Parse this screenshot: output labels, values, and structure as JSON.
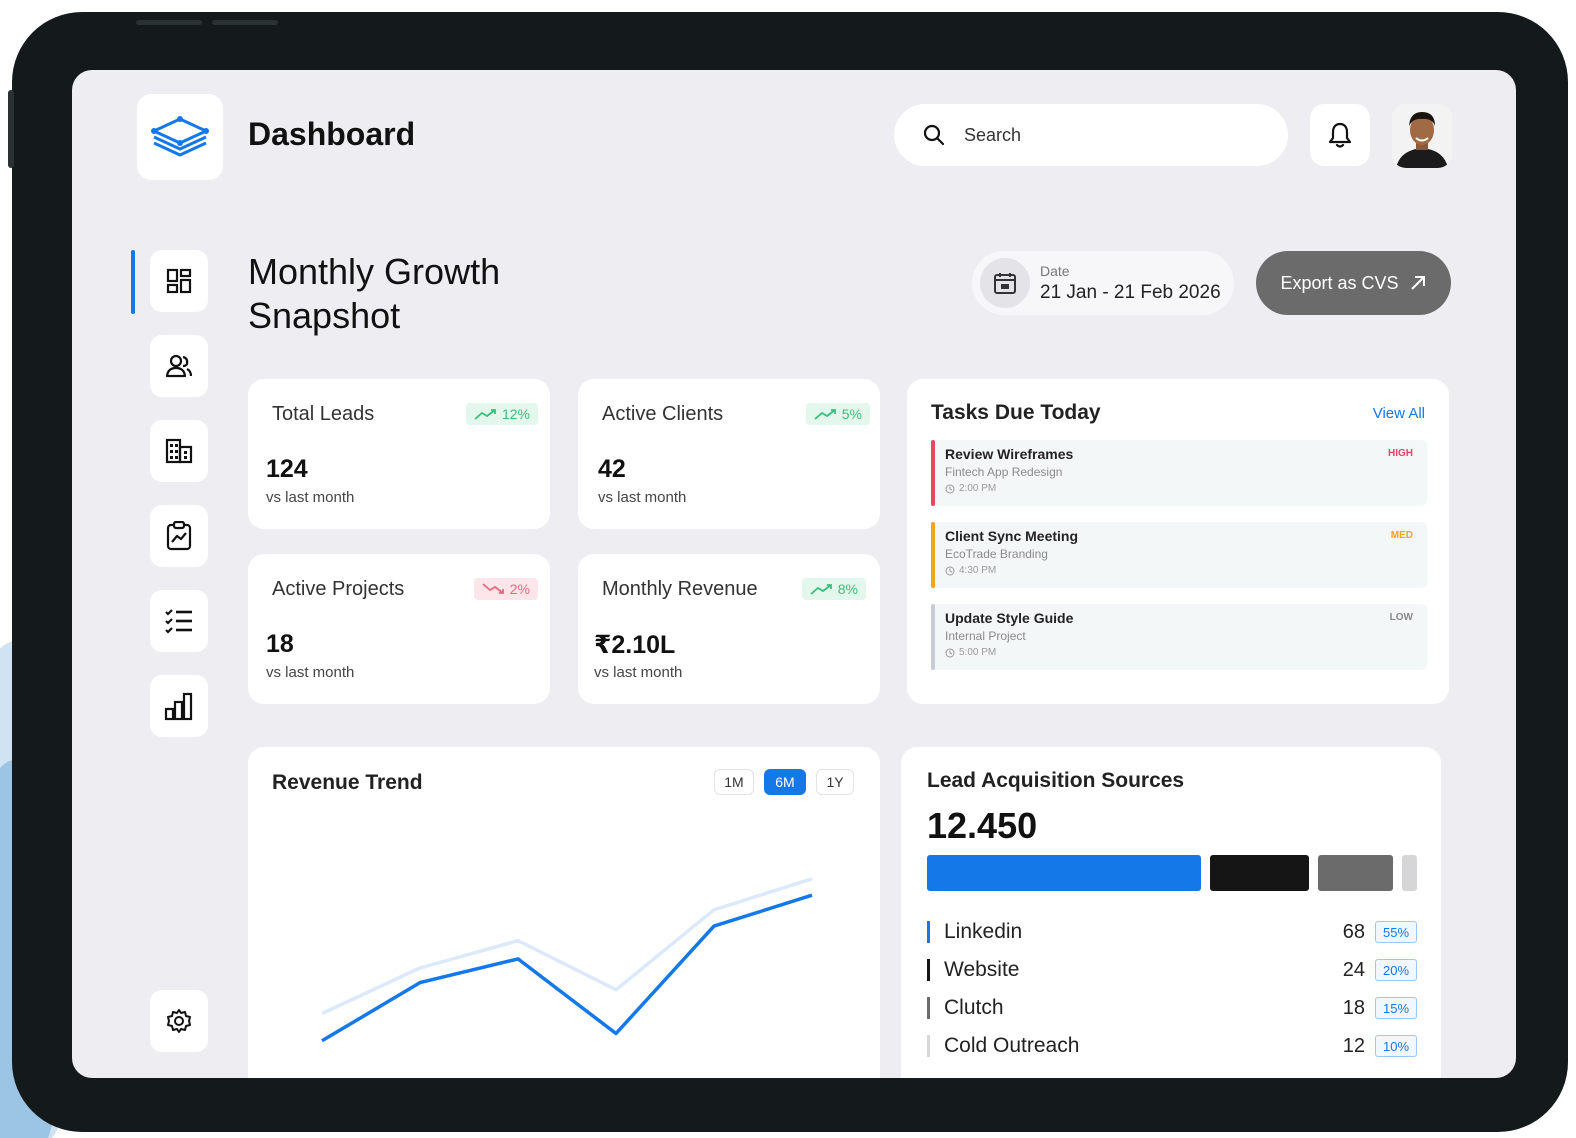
{
  "header": {
    "title": "Dashboard",
    "search_placeholder": "Search"
  },
  "page": {
    "title_line1": "Monthly Growth",
    "title_line2": "Snapshot",
    "date_label": "Date",
    "date_value": "21 Jan - 21 Feb 2026",
    "export_label": "Export as CVS"
  },
  "sidebar": {
    "items": [
      {
        "icon": "dashboard-icon",
        "active": true
      },
      {
        "icon": "users-icon"
      },
      {
        "icon": "building-icon"
      },
      {
        "icon": "report-clipboard-icon"
      },
      {
        "icon": "task-list-icon"
      },
      {
        "icon": "bar-chart-icon"
      },
      {
        "icon": "settings-gear-icon"
      }
    ]
  },
  "stats": [
    {
      "label": "Total Leads",
      "value": "124",
      "sub": "vs last month",
      "change": "12%",
      "trend": "up"
    },
    {
      "label": "Active Clients",
      "value": "42",
      "sub": "vs last month",
      "change": "5%",
      "trend": "up"
    },
    {
      "label": "Active Projects",
      "value": "18",
      "sub": "vs last month",
      "change": "2%",
      "trend": "down"
    },
    {
      "label": "Monthly Revenue",
      "value": "₹2.10L",
      "sub": "vs last month",
      "change": "8%",
      "trend": "up"
    }
  ],
  "tasks": {
    "title": "Tasks Due Today",
    "view_all": "View All",
    "items": [
      {
        "name": "Review Wireframes",
        "project": "Fintech App Redesign",
        "time": "2:00 PM",
        "priority": "HIGH",
        "color": "#e8475f"
      },
      {
        "name": "Client Sync Meeting",
        "project": "EcoTrade Branding",
        "time": "4:30 PM",
        "priority": "MED",
        "color": "#f2a516"
      },
      {
        "name": "Update Style Guide",
        "project": "Internal Project",
        "time": "5:00 PM",
        "priority": "LOW",
        "color": "#c9ccd6"
      }
    ]
  },
  "revenue_trend": {
    "title": "Revenue Trend",
    "ranges": [
      "1M",
      "6M",
      "1Y"
    ],
    "active_range": "6M"
  },
  "chart_data": {
    "type": "line",
    "x": [
      1,
      2,
      3,
      4,
      5,
      6
    ],
    "series": [
      {
        "values": [
          10,
          42,
          55,
          14,
          73,
          90
        ],
        "color": "#1478e8"
      },
      {
        "values": [
          25,
          50,
          65,
          38,
          82,
          99
        ],
        "color": "#dbe9fb"
      }
    ],
    "ylim": [
      0,
      100
    ],
    "grid": false
  },
  "leads": {
    "title": "Lead Acquisition Sources",
    "total": "12.450",
    "sources": [
      {
        "name": "Linkedin",
        "count": "68",
        "pct": "55%",
        "share": 55,
        "color": "#1478e8"
      },
      {
        "name": "Website",
        "count": "24",
        "pct": "20%",
        "share": 20,
        "color": "#151515"
      },
      {
        "name": "Clutch",
        "count": "18",
        "pct": "15%",
        "share": 15,
        "color": "#6b6b6b"
      },
      {
        "name": "Cold Outreach",
        "count": "12",
        "pct": "10%",
        "share": 3,
        "color": "#d6d6d9"
      }
    ]
  }
}
